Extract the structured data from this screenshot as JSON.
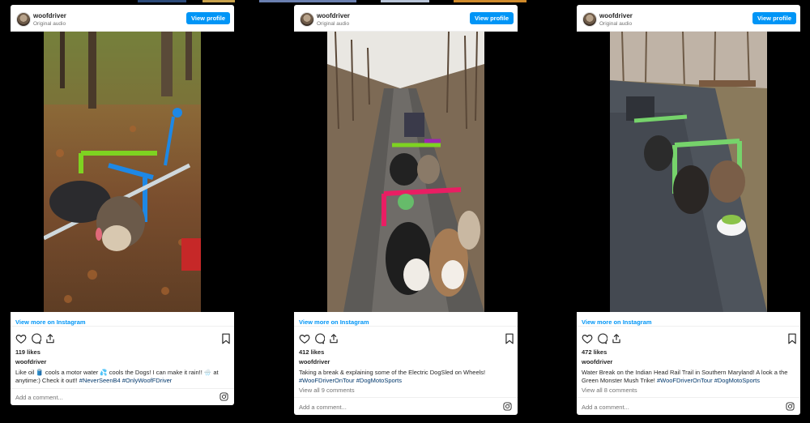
{
  "colors": {
    "accent": "#0095f6",
    "hashtag": "#00376b",
    "bg": "#000000"
  },
  "cards": [
    {
      "username": "woofdriver",
      "subtitle": "Original audio",
      "view_profile": "View profile",
      "view_more": "View more on Instagram",
      "likes": "119 likes",
      "author": "woofdriver",
      "caption_text": "Like oil 🛢️ cools a motor water 💦 cools the Dogs! I can make it rain!! 🌧️ at anytime:) Check it out!!",
      "hashtags": [
        "#NeverSeenB4",
        "#OnlyWoofFDriver"
      ],
      "comments": "",
      "add_comment": "Add a comment...",
      "icons": [
        "heart-icon",
        "comment-icon",
        "share-icon",
        "bookmark-icon",
        "instagram-icon"
      ]
    },
    {
      "username": "woofdriver",
      "subtitle": "Original audio",
      "view_profile": "View profile",
      "view_more": "View more on Instagram",
      "likes": "412 likes",
      "author": "woofdriver",
      "caption_text": "Taking a break & explaining some of the Electric DogSled on Wheels!",
      "hashtags": [
        "#WooFDriverOnTour",
        "#DogMotoSports"
      ],
      "comments": "View all 9 comments",
      "add_comment": "Add a comment...",
      "icons": [
        "heart-icon",
        "comment-icon",
        "share-icon",
        "bookmark-icon",
        "instagram-icon"
      ]
    },
    {
      "username": "woofdriver",
      "subtitle": "Original audio",
      "view_profile": "View profile",
      "view_more": "View more on Instagram",
      "likes": "472 likes",
      "author": "woofdriver",
      "caption_text": "Water Break on the Indian Head Rail Trail in Southern Maryland! A look a the Green Monster Mush Trike!",
      "hashtags": [
        "#WooFDriverOnTour",
        "#DogMotoSports"
      ],
      "comments": "View all 8 comments",
      "add_comment": "Add a comment...",
      "icons": [
        "heart-icon",
        "comment-icon",
        "share-icon",
        "bookmark-icon",
        "instagram-icon"
      ]
    }
  ]
}
